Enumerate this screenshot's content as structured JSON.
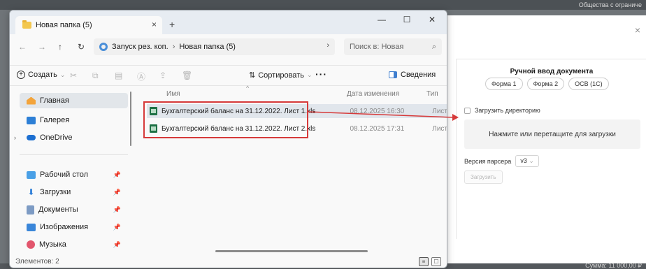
{
  "background": {
    "top_right_text": "Общества с ограниче",
    "bottom_right_text": "Сумма: 11 000,00 ₽",
    "dialog": {
      "close_glyph": "×",
      "title": "Ручной ввод документа",
      "form_buttons": [
        "Форма 1",
        "Форма 2",
        "ОСВ (1С)"
      ],
      "load_directory_label": "Загрузить директорию",
      "dropzone_text": "Нажмите или перетащите для загрузки",
      "parser_label": "Версия парсера",
      "parser_value": "v3",
      "upload_button": "Загрузить"
    }
  },
  "explorer": {
    "tab_title": "Новая папка (5)",
    "tab_close": "×",
    "new_tab": "+",
    "window_controls": {
      "minimize": "—",
      "maximize": "☐",
      "close": "✕"
    },
    "nav": {
      "back": "←",
      "forward": "→",
      "up": "↑",
      "refresh": "↻"
    },
    "breadcrumb": [
      "Запуск рез. коп.",
      "Новая папка (5)"
    ],
    "breadcrumb_sep": "›",
    "breadcrumb_expand": "›",
    "search_placeholder": "Поиск в: Новая",
    "search_icon": "⌕",
    "toolbar": {
      "create": "Создать",
      "create_chevron": "⌄",
      "sort": "Сортировать",
      "sort_icon": "⇅",
      "sort_chevron": "⌄",
      "more": "···",
      "details": "Сведения"
    },
    "sidebar": {
      "home": "Главная",
      "gallery": "Галерея",
      "onedrive": "OneDrive",
      "expand": "›",
      "pin": "📌",
      "pinned": [
        "Рабочий стол",
        "Загрузки",
        "Документы",
        "Изображения",
        "Музыка"
      ]
    },
    "columns": {
      "name": "Имя",
      "date": "Дата изменения",
      "type": "Тип",
      "sort_arrow": "^"
    },
    "files": [
      {
        "name": "Бухгалтерский баланс на 31.12.2022. Лист 1.xls",
        "date": "08.12.2025 16:30",
        "type": "Лист N"
      },
      {
        "name": "Бухгалтерский баланс на 31.12.2022. Лист 2.xls",
        "date": "08.12.2025 17:31",
        "type": "Лист N"
      }
    ],
    "status": "Элементов: 2",
    "view_buttons": [
      "≡",
      "☐"
    ]
  },
  "colors": {
    "annotation": "#d63a3a",
    "accent": "#2f7fd8",
    "excel": "#1e7145"
  }
}
